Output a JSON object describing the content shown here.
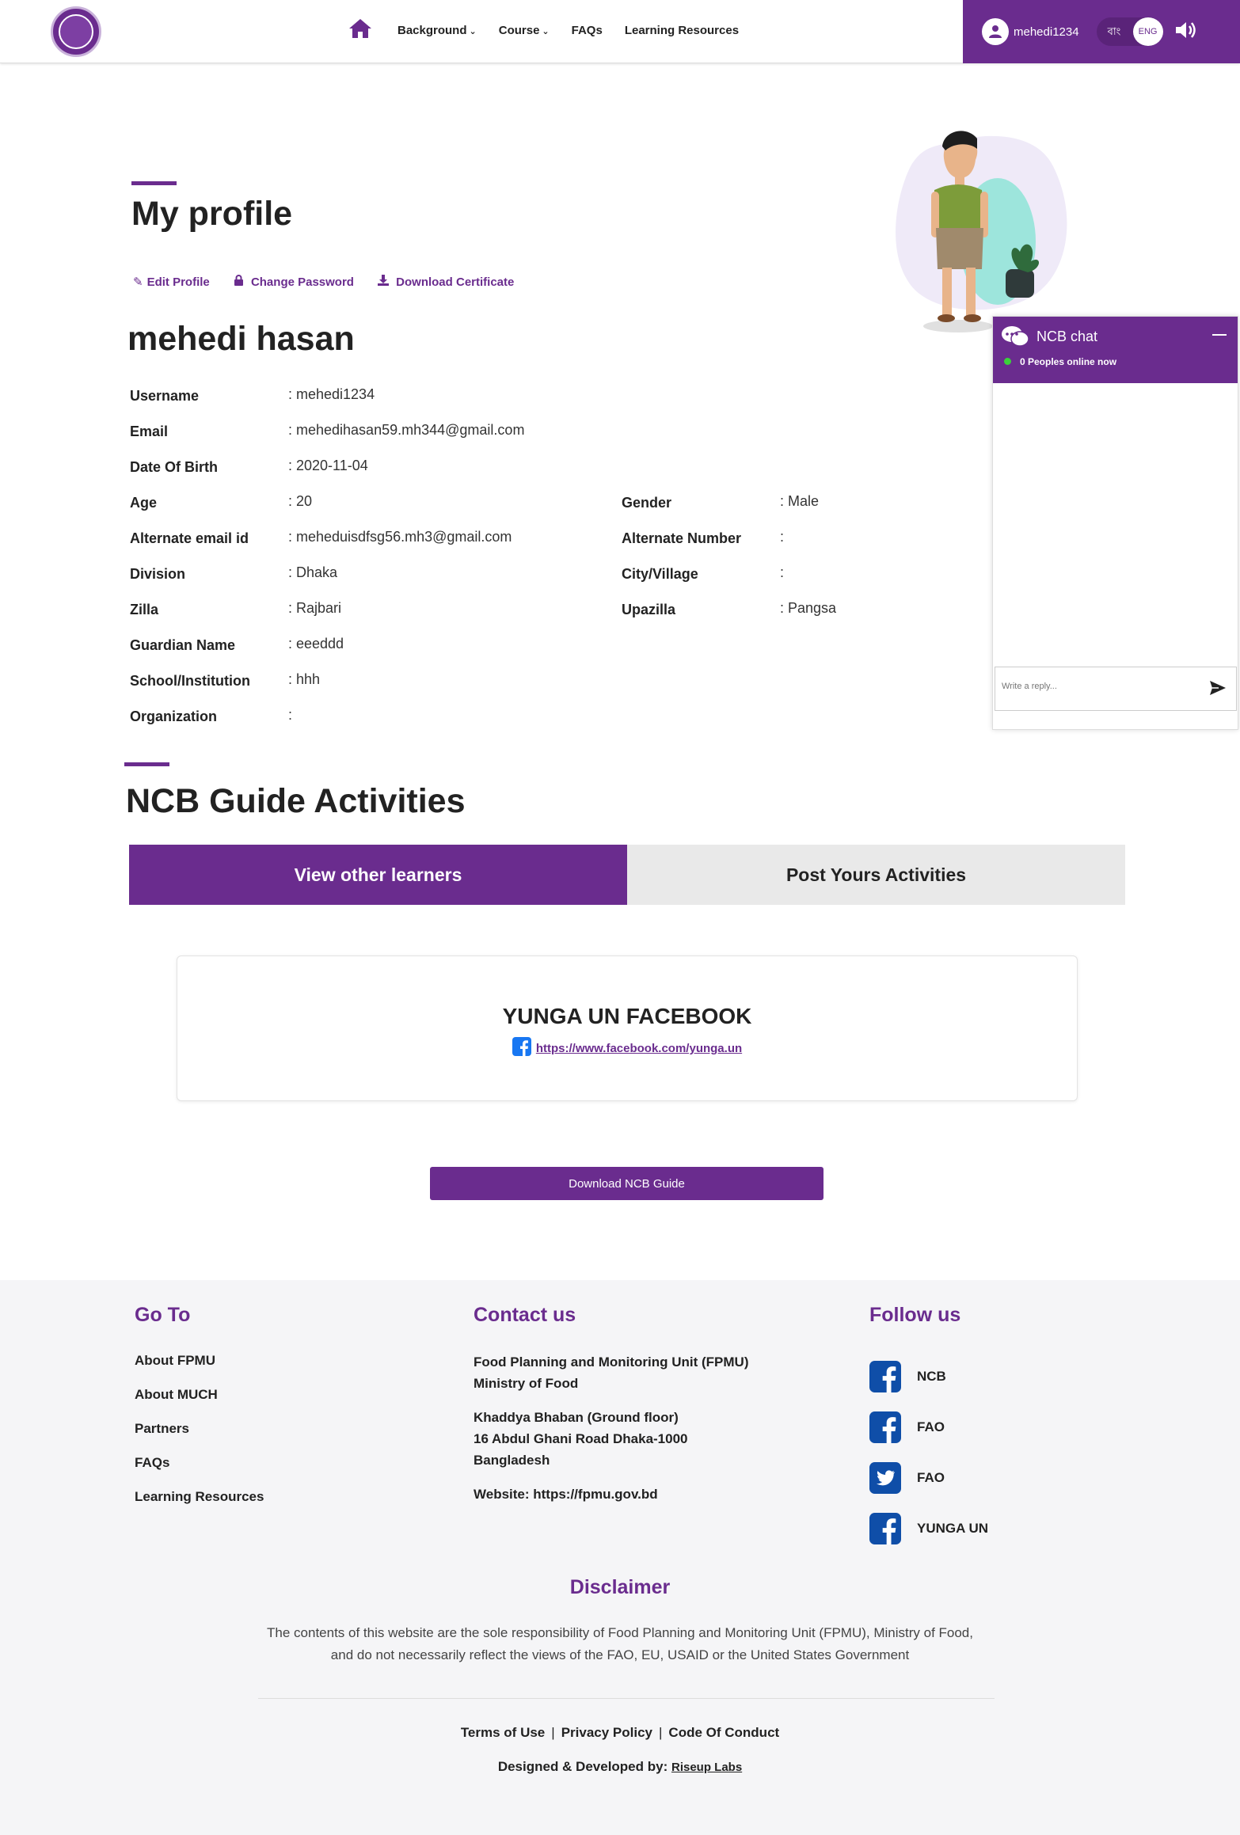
{
  "nav": {
    "items": [
      {
        "label": "Background",
        "has_dropdown": true
      },
      {
        "label": "Course",
        "has_dropdown": true
      },
      {
        "label": "FAQs",
        "has_dropdown": false
      },
      {
        "label": "Learning Resources",
        "has_dropdown": false
      }
    ],
    "username": "mehedi1234",
    "lang_bn": "বাং",
    "lang_en": "ENG"
  },
  "profile": {
    "heading": "My profile",
    "actions": {
      "edit": "Edit Profile",
      "password": "Change Password",
      "certificate": "Download Certificate"
    },
    "full_name": "mehedi hasan",
    "fields": {
      "username": {
        "label": "Username",
        "value": ": mehedi1234"
      },
      "email": {
        "label": "Email",
        "value": ": mehedihasan59.mh344@gmail.com"
      },
      "dob": {
        "label": "Date Of Birth",
        "value": ": 2020-11-04"
      },
      "age": {
        "label": "Age",
        "value": ": 20"
      },
      "gender": {
        "label": "Gender",
        "value": ": Male"
      },
      "alt_email": {
        "label": "Alternate email id",
        "value": ": meheduisdfsg56.mh3@gmail.com"
      },
      "alt_number": {
        "label": "Alternate Number",
        "value": ":"
      },
      "division": {
        "label": "Division",
        "value": ": Dhaka"
      },
      "city": {
        "label": "City/Village",
        "value": ":"
      },
      "zilla": {
        "label": "Zilla",
        "value": ": Rajbari"
      },
      "upazilla": {
        "label": "Upazilla",
        "value": ": Pangsa"
      },
      "guardian": {
        "label": "Guardian Name",
        "value": ": eeeddd"
      },
      "school": {
        "label": "School/Institution",
        "value": ": hhh"
      },
      "organization": {
        "label": "Organization",
        "value": ":"
      }
    }
  },
  "chat": {
    "title": "NCB chat",
    "status": "0 Peoples online now",
    "placeholder": "Write a reply..."
  },
  "activities": {
    "heading": "NCB Guide Activities",
    "tab_active": "View other learners",
    "tab_inactive": "Post Yours Activities",
    "card_title": "YUNGA UN FACEBOOK",
    "card_link": "https://www.facebook.com/yunga.un",
    "download_button": "Download NCB Guide"
  },
  "footer": {
    "goto_heading": "Go To",
    "goto_links": [
      "About FPMU",
      "About MUCH",
      "Partners",
      "FAQs",
      "Learning Resources"
    ],
    "contact_heading": "Contact us",
    "contact_line1": "Food Planning and Monitoring Unit (FPMU)",
    "contact_line2": "Ministry of Food",
    "address_line1": "Khaddya Bhaban (Ground floor)",
    "address_line2": "16 Abdul Ghani Road Dhaka-1000",
    "address_line3": "Bangladesh",
    "website": "Website: https://fpmu.gov.bd",
    "follow_heading": "Follow us",
    "follow": [
      {
        "icon": "facebook-icon",
        "label": "NCB"
      },
      {
        "icon": "facebook-icon",
        "label": "FAO"
      },
      {
        "icon": "twitter-icon",
        "label": "FAO"
      },
      {
        "icon": "facebook-icon",
        "label": "YUNGA UN"
      }
    ],
    "disclaimer_heading": "Disclaimer",
    "disclaimer_text": "The contents of this website are the sole responsibility of Food Planning and Monitoring Unit (FPMU), Ministry of Food, and do not necessarily reflect the views of the FAO, EU, USAID or the United States Government",
    "policy_links": [
      "Terms of Use",
      "Privacy Policy",
      "Code Of Conduct"
    ],
    "policy_sep": "|",
    "credit_prefix": "Designed & Developed by:",
    "credit_link": "Riseup Labs"
  },
  "colors": {
    "brand": "#6a2c8e",
    "online": "#3ad23a",
    "facebook": "#1877f2",
    "twitter": "#1d9bf0"
  }
}
